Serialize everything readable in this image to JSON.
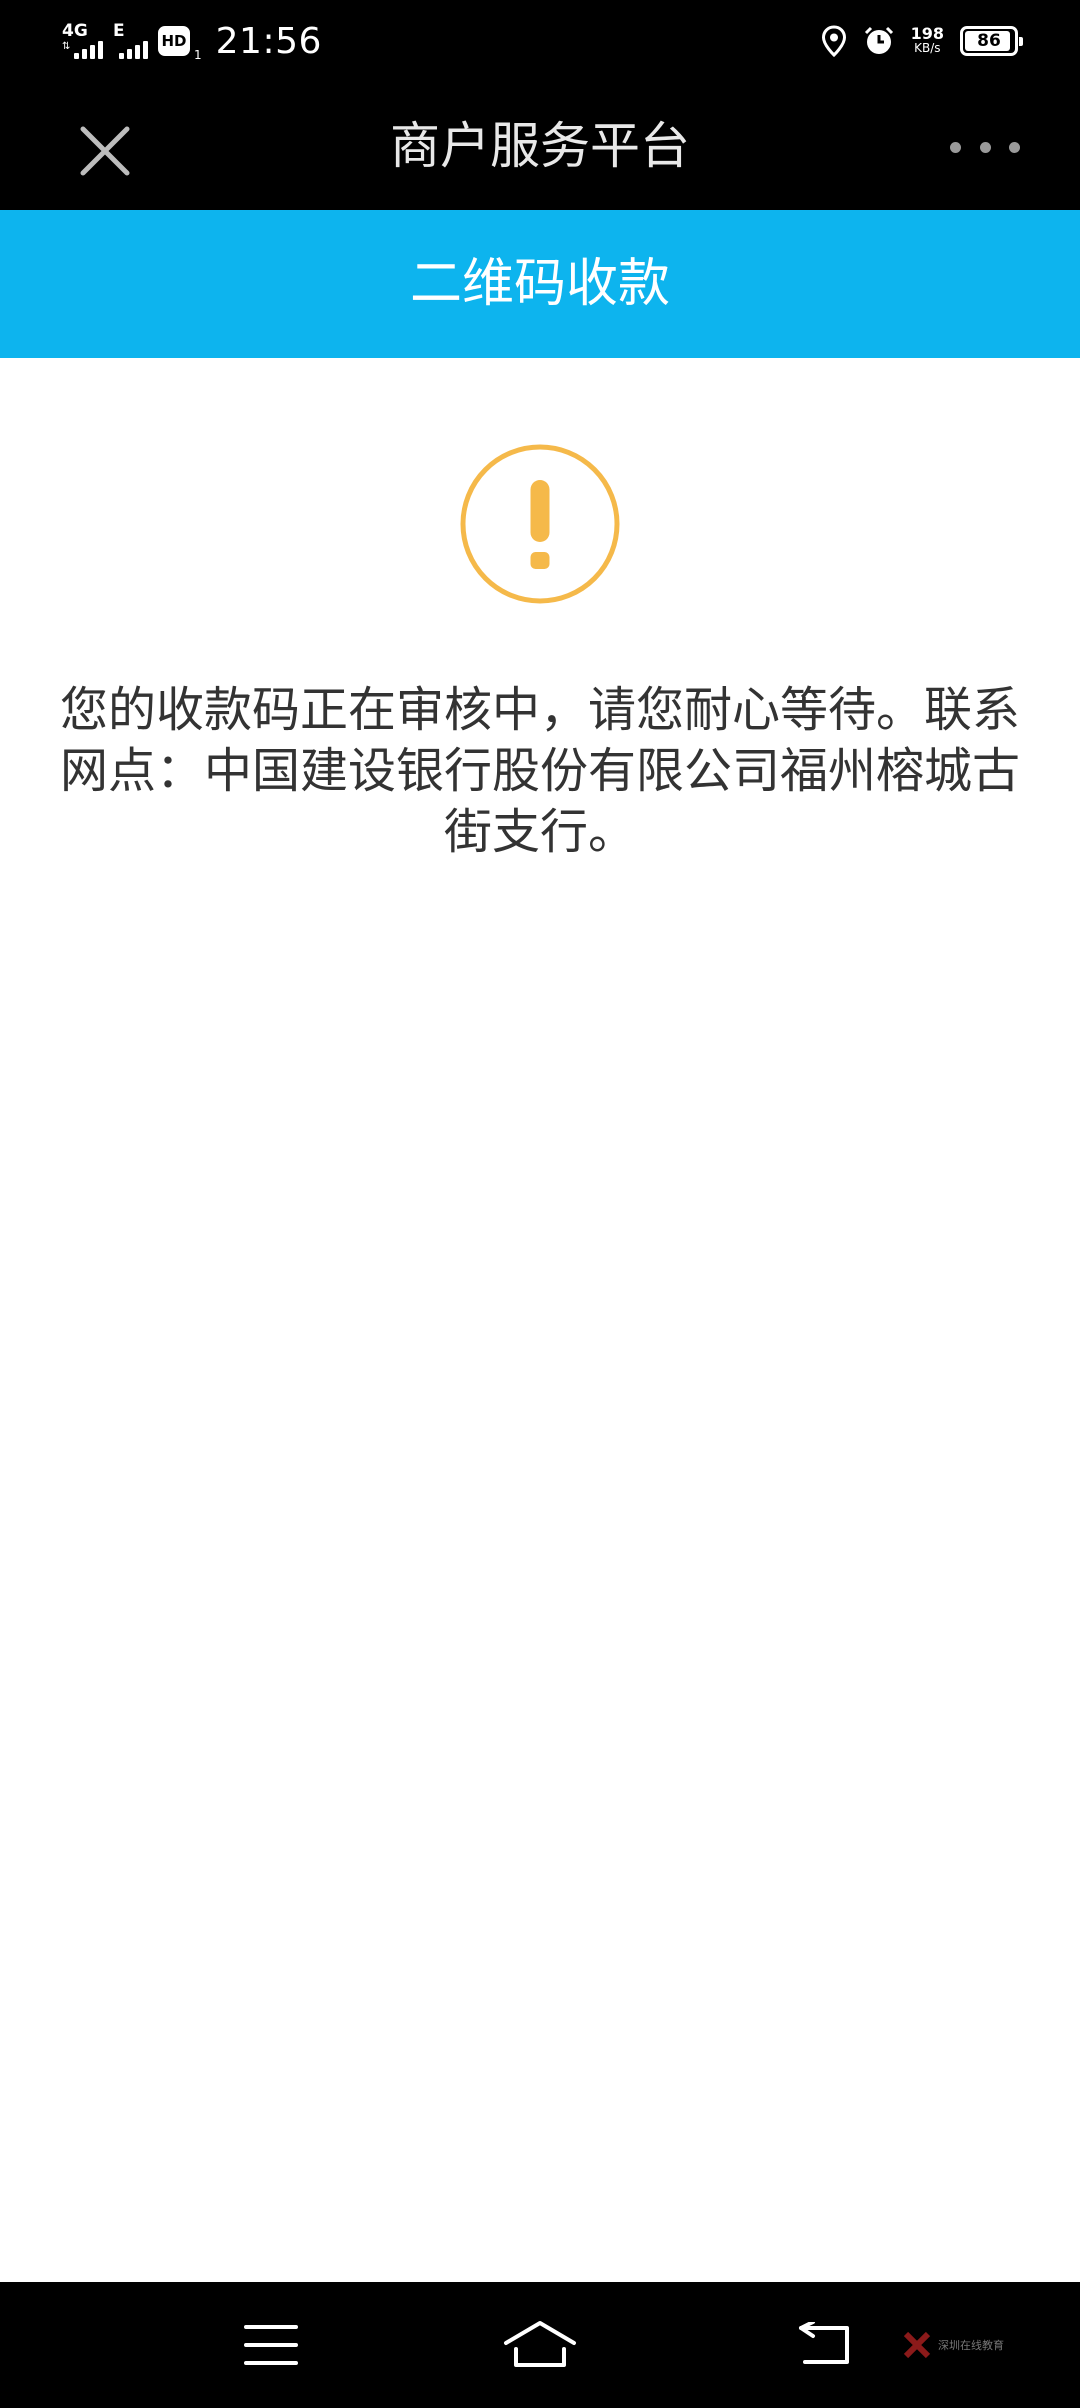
{
  "status_bar": {
    "network1": "4G",
    "network2": "E",
    "hd": "HD",
    "hd_sub": "1",
    "time": "21:56",
    "speed_value": "198",
    "speed_unit": "KB/s",
    "battery_level": "86"
  },
  "title_bar": {
    "title": "商户服务平台",
    "close_icon": "close-icon",
    "more_icon": "more-dots-icon"
  },
  "header": {
    "title": "二维码收款",
    "background_color": "#0db4ee"
  },
  "content": {
    "icon": "exclamation-circle-icon",
    "icon_color": "#f5b94a",
    "message_lines": [
      "您的收款码正在审核中，请您耐心等待。联系",
      "网点：中国建设银行股份有限公司福州榕城古",
      "街支行。"
    ]
  },
  "nav_bar": {
    "menu_icon": "menu-icon",
    "home_icon": "home-icon",
    "back_icon": "back-icon",
    "watermark_text": "深圳在线教育"
  }
}
